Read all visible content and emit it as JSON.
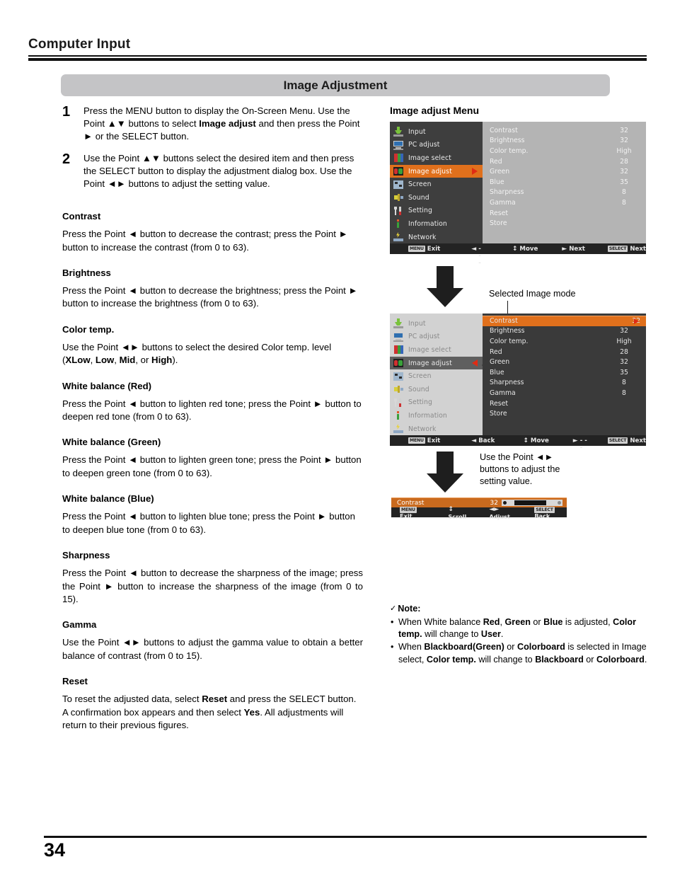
{
  "header": {
    "title": "Computer Input"
  },
  "banner": {
    "title": "Image Adjustment"
  },
  "steps": [
    {
      "num": "1",
      "html_text": "Press the MENU button to display the On-Screen Menu. Use the Point ▲▼ buttons to select Image adjust and then press the Point ► or the SELECT button."
    },
    {
      "num": "2",
      "html_text": "Use the Point ▲▼ buttons select the desired item and then press the SELECT button to display the adjustment dialog box. Use the Point ◄► buttons to adjust the setting value."
    }
  ],
  "sections": [
    {
      "heading": "Contrast",
      "body": "Press the Point ◄ button to decrease the contrast; press the Point ► button to increase the contrast (from 0 to 63)."
    },
    {
      "heading": "Brightness",
      "body": "Press the Point ◄ button to decrease the brightness; press the Point ► button to increase the brightness (from 0 to 63)."
    },
    {
      "heading": "Color temp.",
      "body": "Use the Point ◄► buttons to select the desired Color temp. level (XLow, Low, Mid, or High)."
    },
    {
      "heading": "White balance (Red)",
      "body": "Press the Point ◄ button to lighten red tone; press the Point ► button to deepen red tone (from 0 to 63)."
    },
    {
      "heading": "White balance (Green)",
      "body": "Press the Point ◄ button to lighten green tone; press the Point ► button to deepen green tone (from 0 to 63)."
    },
    {
      "heading": "White balance (Blue)",
      "body": "Press the Point ◄ button to lighten blue tone; press the Point ► button to deepen blue tone (from 0 to 63)."
    },
    {
      "heading": "Sharpness",
      "body": "Press the Point ◄ button to decrease the sharpness of the image; press the Point ► button to increase the sharpness of the image (from 0 to 15)."
    },
    {
      "heading": "Gamma",
      "body": "Use the Point ◄► buttons to adjust the gamma value to obtain a better balance of contrast (from 0 to 15)."
    },
    {
      "heading": "Reset",
      "body": "To reset the adjusted data, select Reset and press the SELECT button. A confirmation box appears and then select Yes. All adjustments will return to their previous figures."
    }
  ],
  "osd": {
    "caption": "Image adjust Menu",
    "sidebar_items": [
      {
        "label": "Input",
        "icon": "input-icon"
      },
      {
        "label": "PC adjust",
        "icon": "pc-adjust-icon"
      },
      {
        "label": "Image select",
        "icon": "image-select-icon"
      },
      {
        "label": "Image adjust",
        "icon": "image-adjust-icon"
      },
      {
        "label": "Screen",
        "icon": "screen-icon"
      },
      {
        "label": "Sound",
        "icon": "sound-icon"
      },
      {
        "label": "Setting",
        "icon": "setting-icon"
      },
      {
        "label": "Information",
        "icon": "information-icon"
      },
      {
        "label": "Network",
        "icon": "network-icon"
      }
    ],
    "selected_sidebar": "Image adjust",
    "menu_items": [
      {
        "name": "Contrast",
        "value": "32"
      },
      {
        "name": "Brightness",
        "value": "32"
      },
      {
        "name": "Color temp.",
        "value": "High"
      },
      {
        "name": "Red",
        "value": "28"
      },
      {
        "name": "Green",
        "value": "32"
      },
      {
        "name": "Blue",
        "value": "35"
      },
      {
        "name": "Sharpness",
        "value": "8"
      },
      {
        "name": "Gamma",
        "value": "8"
      },
      {
        "name": "Reset",
        "value": ""
      },
      {
        "name": "Store",
        "value": ""
      }
    ],
    "footer_1": [
      {
        "key": "MENU",
        "label": "Exit",
        "glyph": ""
      },
      {
        "key": "",
        "label": "- - - - -",
        "glyph": "◄"
      },
      {
        "key": "",
        "label": "Move",
        "glyph": "↕"
      },
      {
        "key": "",
        "label": "Next",
        "glyph": "►"
      },
      {
        "key": "SELECT",
        "label": "Next",
        "glyph": ""
      }
    ],
    "footer_2": [
      {
        "key": "MENU",
        "label": "Exit",
        "glyph": ""
      },
      {
        "key": "",
        "label": "Back",
        "glyph": "◄"
      },
      {
        "key": "",
        "label": "Move",
        "glyph": "↕"
      },
      {
        "key": "",
        "label": "- - - - -",
        "glyph": "►"
      },
      {
        "key": "SELECT",
        "label": "Next",
        "glyph": ""
      }
    ],
    "adjust_bar": {
      "name": "Contrast",
      "value": "32",
      "footer": [
        {
          "key": "MENU",
          "label": "Exit",
          "glyph": ""
        },
        {
          "key": "",
          "label": "Scroll",
          "glyph": "↕"
        },
        {
          "key": "",
          "label": "Adjust",
          "glyph": "◄►"
        },
        {
          "key": "SELECT",
          "label": "Back",
          "glyph": ""
        }
      ]
    },
    "highlighted_row": "Contrast"
  },
  "callouts": {
    "selected_image_mode": "Selected Image mode",
    "use_point_buttons": "Use the Point ◄► buttons to adjust the setting value."
  },
  "note": {
    "heading": "Note:",
    "check": "✓",
    "items": [
      "When White balance Red, Green or Blue is adjusted, Color temp. will change to User.",
      "When Blackboard(Green) or Colorboard is selected in Image select, Color temp. will change to Blackboard or Colorboard."
    ]
  },
  "footer": {
    "page_number": "34"
  },
  "colors": {
    "accent_orange": "#e0701c",
    "caret_red": "#e02b14",
    "banner_gray": "#c4c4c6",
    "osd_dark": "#3e3e3e",
    "osd_panel": "#b4b4b4"
  }
}
